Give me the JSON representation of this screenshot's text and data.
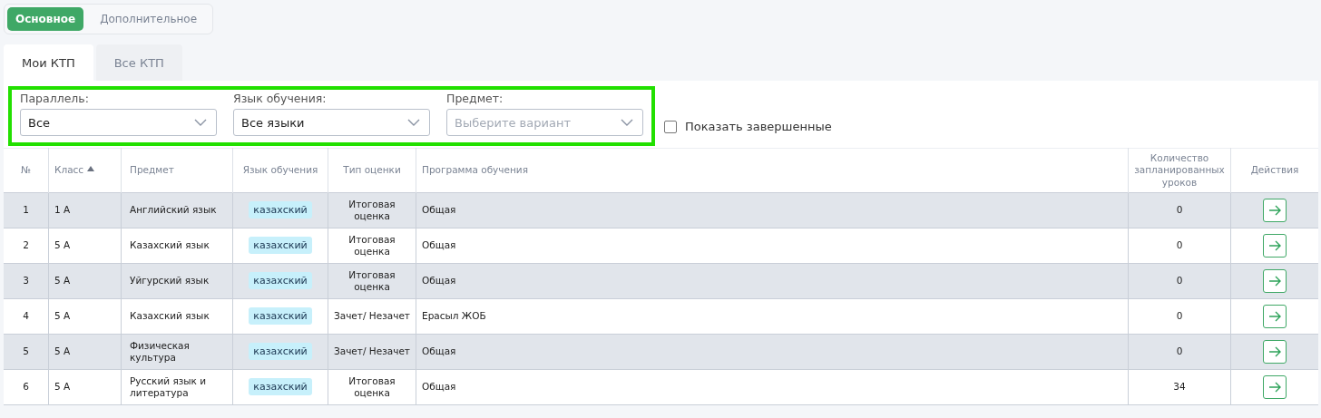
{
  "segments": [
    {
      "label": "Основное",
      "selected": true
    },
    {
      "label": "Дополнительное",
      "selected": false
    }
  ],
  "tabs": [
    {
      "label": "Мои КТП",
      "selected": true
    },
    {
      "label": "Все КТП",
      "selected": false
    }
  ],
  "filters": [
    {
      "label": "Параллель:",
      "value": "Все"
    },
    {
      "label": "Язык обучения:",
      "value": "Все языки"
    },
    {
      "label": "Предмет:",
      "placeholder": "Выберите вариант"
    }
  ],
  "show_finished": {
    "label": "Показать завершенные",
    "checked": false
  },
  "table": {
    "columns": [
      {
        "label": "№",
        "sorted": false
      },
      {
        "label": "Класс",
        "sorted": true
      },
      {
        "label": "Предмет",
        "sorted": false
      },
      {
        "label": "Язык обучения",
        "sorted": false
      },
      {
        "label": "Тип оценки",
        "sorted": false
      },
      {
        "label": "Программа обучения",
        "sorted": false
      },
      {
        "label": "Количество запланированных уроков",
        "sorted": false
      },
      {
        "label": "Действия",
        "sorted": false
      }
    ],
    "rows": [
      {
        "n": "1",
        "class": "1 А",
        "subject": "Английский язык",
        "language": "казахский",
        "grading": "Итоговая оценка",
        "program": "Общая",
        "lessons": "0"
      },
      {
        "n": "2",
        "class": "5 А",
        "subject": "Казахский язык",
        "language": "казахский",
        "grading": "Итоговая оценка",
        "program": "Общая",
        "lessons": "0"
      },
      {
        "n": "3",
        "class": "5 А",
        "subject": "Уйгурский язык",
        "language": "казахский",
        "grading": "Итоговая оценка",
        "program": "Общая",
        "lessons": "0"
      },
      {
        "n": "4",
        "class": "5 А",
        "subject": "Казахский язык",
        "language": "казахский",
        "grading": "Зачет/ Незачет",
        "program": "Ерасыл ЖОБ",
        "lessons": "0"
      },
      {
        "n": "5",
        "class": "5 А",
        "subject": "Физическая культура",
        "language": "казахский",
        "grading": "Зачет/ Незачет",
        "program": "Общая",
        "lessons": "0"
      },
      {
        "n": "6",
        "class": "5 А",
        "subject": "Русский язык и литература",
        "language": "казахский",
        "grading": "Итоговая оценка",
        "program": "Общая",
        "lessons": "34"
      }
    ]
  }
}
